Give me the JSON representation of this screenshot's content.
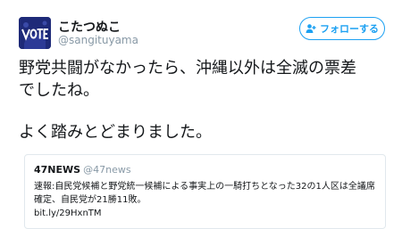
{
  "author": {
    "display_name": "こたつぬこ",
    "screen_name": "@sangituyama"
  },
  "follow_button": {
    "label": "フォローする",
    "icon": "add-person-icon"
  },
  "tweet": {
    "lines": [
      "野党共闘がなかったら、沖縄以外は全滅の票差",
      "でしたね。",
      "よく踏みとどまりました。"
    ]
  },
  "quoted_tweet": {
    "display_name": "47NEWS",
    "screen_name": "@47news",
    "lines": [
      "速報:自民党候補と野党統一候補による事実上の一騎打ちとなった32の1人区は全議席",
      "確定、自民党が21勝11敗。",
      "bit.ly/29HxnTM"
    ]
  },
  "colors": {
    "accent": "#1da1f2",
    "secondary_text": "#8899a6",
    "border": "#e1e8ed"
  }
}
